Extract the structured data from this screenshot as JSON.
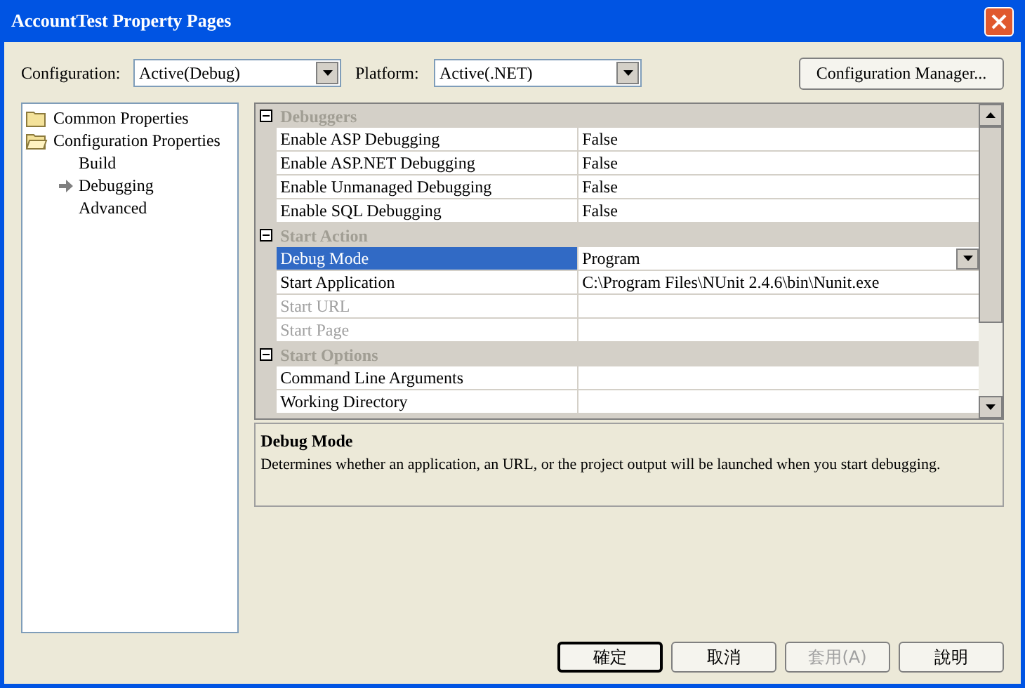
{
  "window": {
    "title": "AccountTest Property Pages"
  },
  "configuration": {
    "label": "Configuration:",
    "value": "Active(Debug)"
  },
  "platform": {
    "label": "Platform:",
    "value": "Active(.NET)"
  },
  "configuration_manager_button": "Configuration Manager...",
  "tree": [
    {
      "label": "Common Properties",
      "expanded": false,
      "selected": false
    },
    {
      "label": "Configuration Properties",
      "expanded": true,
      "selected": false,
      "children": [
        {
          "label": "Build",
          "selected": false
        },
        {
          "label": "Debugging",
          "selected": true
        },
        {
          "label": "Advanced",
          "selected": false
        }
      ]
    }
  ],
  "grid": {
    "groups": [
      {
        "title": "Debuggers",
        "expanded": true,
        "rows": [
          {
            "name": "Enable ASP Debugging",
            "value": "False",
            "disabled": false,
            "selected": false
          },
          {
            "name": "Enable ASP.NET Debugging",
            "value": "False",
            "disabled": false,
            "selected": false
          },
          {
            "name": "Enable Unmanaged Debugging",
            "value": "False",
            "disabled": false,
            "selected": false
          },
          {
            "name": "Enable SQL Debugging",
            "value": "False",
            "disabled": false,
            "selected": false
          }
        ]
      },
      {
        "title": "Start Action",
        "expanded": true,
        "rows": [
          {
            "name": "Debug Mode",
            "value": "Program",
            "disabled": false,
            "selected": true
          },
          {
            "name": "Start Application",
            "value": "C:\\Program Files\\NUnit 2.4.6\\bin\\Nunit.exe",
            "disabled": false,
            "selected": false
          },
          {
            "name": "Start URL",
            "value": "",
            "disabled": true,
            "selected": false
          },
          {
            "name": "Start Page",
            "value": "",
            "disabled": true,
            "selected": false
          }
        ]
      },
      {
        "title": "Start Options",
        "expanded": true,
        "rows": [
          {
            "name": "Command Line Arguments",
            "value": "",
            "disabled": false,
            "selected": false
          },
          {
            "name": "Working Directory",
            "value": "",
            "disabled": false,
            "selected": false
          }
        ]
      }
    ]
  },
  "description": {
    "title": "Debug Mode",
    "text": "Determines whether an application, an URL, or the project output will be launched when you start debugging."
  },
  "buttons": [
    {
      "label": "確定",
      "default": true,
      "disabled": false
    },
    {
      "label": "取消",
      "default": false,
      "disabled": false
    },
    {
      "label": "套用(A)",
      "default": false,
      "disabled": true
    },
    {
      "label": "說明",
      "default": false,
      "disabled": false
    }
  ]
}
